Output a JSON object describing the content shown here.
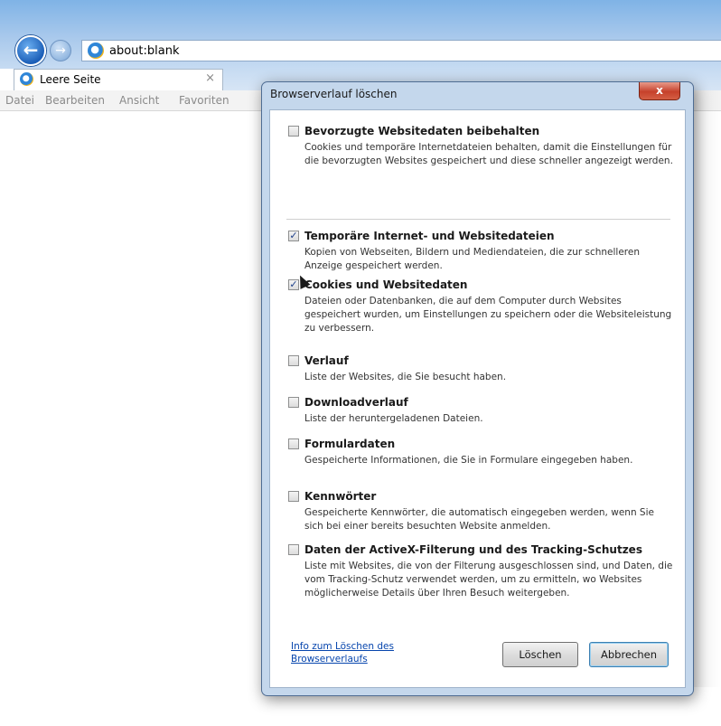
{
  "browser": {
    "address": "about:blank",
    "back_icon": "back-arrow-icon",
    "forward_icon": "forward-arrow-icon",
    "tab_title": "Leere Seite",
    "tab_close": "×",
    "menu": [
      "Datei",
      "Bearbeiten",
      "Ansicht",
      "Favoriten"
    ]
  },
  "dialog": {
    "title": "Browserverlauf löschen",
    "close_label": "x",
    "options": [
      {
        "title": "Bevorzugte Websitedaten beibehalten",
        "checked": false,
        "description": "Cookies und temporäre Internetdateien behalten, damit die Einstellungen für die bevorzugten Websites gespeichert und diese schneller angezeigt werden."
      },
      {
        "title": "Temporäre Internet- und Websitedateien",
        "checked": true,
        "description": "Kopien von Webseiten, Bildern und Mediendateien, die zur schnelleren Anzeige gespeichert werden."
      },
      {
        "title": "Cookies und Websitedaten",
        "checked": true,
        "description": "Dateien oder Datenbanken, die auf dem Computer durch Websites gespeichert wurden, um Einstellungen zu speichern oder die Websiteleistung zu verbessern."
      },
      {
        "title": "Verlauf",
        "checked": false,
        "description": "Liste der Websites, die Sie besucht haben."
      },
      {
        "title": "Downloadverlauf",
        "checked": false,
        "description": "Liste der heruntergeladenen Dateien."
      },
      {
        "title": "Formulardaten",
        "checked": false,
        "description": "Gespeicherte Informationen, die Sie in Formulare eingegeben haben."
      },
      {
        "title": "Kennwörter",
        "checked": false,
        "description": "Gespeicherte Kennwörter, die automatisch eingegeben werden, wenn Sie sich bei einer bereits besuchten Website anmelden."
      },
      {
        "title": "Daten der ActiveX-Filterung und des Tracking-Schutzes",
        "checked": false,
        "description": "Liste mit Websites, die von der Filterung ausgeschlossen sind, und Daten, die vom Tracking-Schutz verwendet werden, um zu ermitteln, wo Websites möglicherweise Details über Ihren Besuch weitergeben."
      }
    ],
    "info_link": "Info zum Löschen des Browserverlaufs",
    "delete_label": "Löschen",
    "cancel_label": "Abbrechen"
  }
}
